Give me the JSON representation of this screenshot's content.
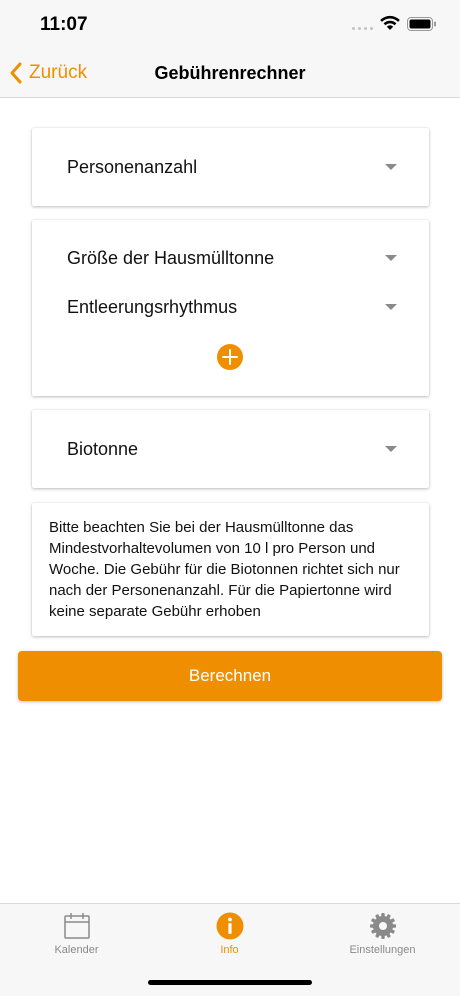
{
  "status_bar": {
    "time": "11:07"
  },
  "nav": {
    "back_label": "Zurück",
    "title": "Gebührenrechner"
  },
  "card1": {
    "dropdown1": "Personenanzahl"
  },
  "card2": {
    "dropdown1": "Größe der Hausmülltonne",
    "dropdown2": "Entleerungsrhythmus",
    "add_icon": "plus-circle-icon"
  },
  "card3": {
    "dropdown1": "Biotonne"
  },
  "info_box": {
    "text": "Bitte beachten Sie bei der Hausmülltonne das Mindestvorhaltevolumen von 10 l pro Person und Woche. Die Gebühr für die Biotonnen richtet sich nur nach der Personenanzahl. Für die Papiertonne wird keine separate Gebühr erhoben"
  },
  "calculate_button": "Berechnen",
  "tabs": [
    {
      "label": "Kalender",
      "icon": "calendar-icon",
      "active": false
    },
    {
      "label": "Info",
      "icon": "info-icon",
      "active": true
    },
    {
      "label": "Einstellungen",
      "icon": "gear-icon",
      "active": false
    }
  ],
  "colors": {
    "accent": "#ef8f00",
    "inactive": "#8a8a8a",
    "bar_background": "#f7f7f7"
  }
}
